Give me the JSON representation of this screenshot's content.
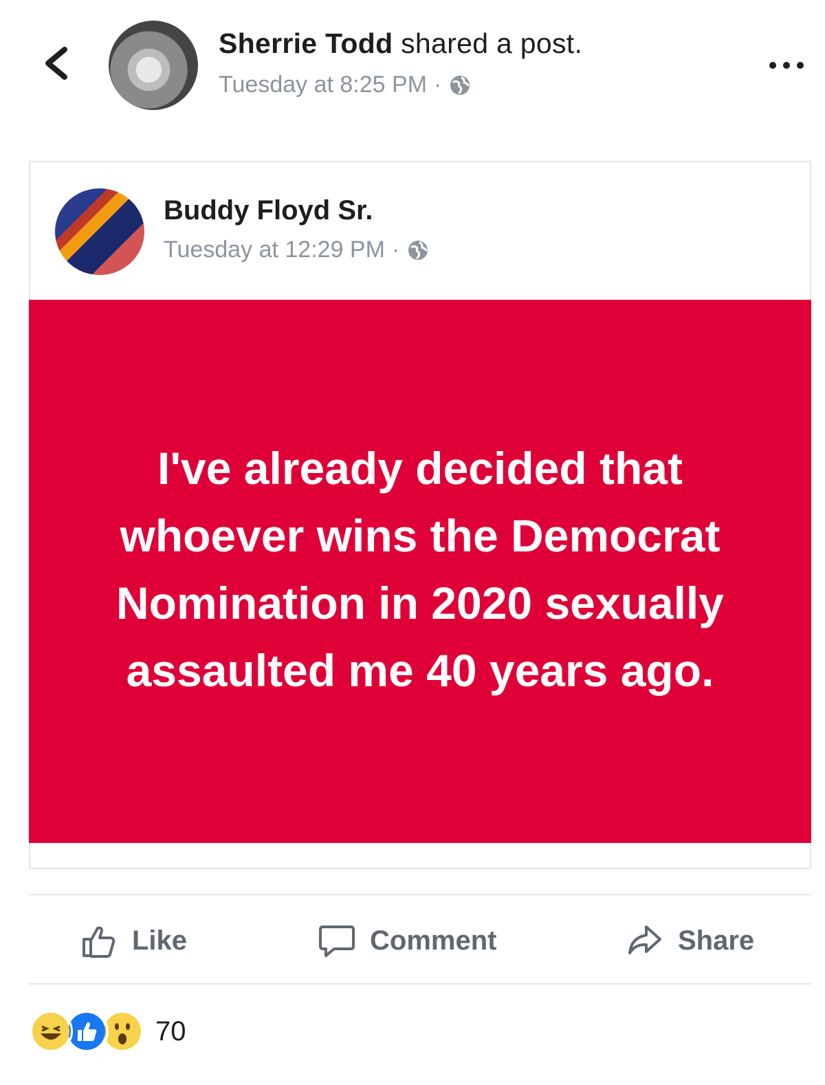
{
  "header": {
    "sharer_name": "Sherrie Todd",
    "sharer_action": " shared a post.",
    "timestamp": "Tuesday at 8:25 PM",
    "separator": "·"
  },
  "shared_post": {
    "author_name": "Buddy Floyd Sr.",
    "timestamp": "Tuesday at 12:29 PM",
    "separator": "·",
    "status_text": "I've already decided that whoever wins the Democrat Nomination in 2020 sexually assaulted me 40 years ago.",
    "background_color": "#e00038"
  },
  "actions": {
    "like_label": "Like",
    "comment_label": "Comment",
    "share_label": "Share"
  },
  "reactions": {
    "icons": [
      "haha-icon",
      "like-icon",
      "wow-icon"
    ],
    "count": "70"
  },
  "icons": {
    "back": "chevron-left-icon",
    "more": "more-options-icon",
    "privacy": "globe-icon"
  }
}
